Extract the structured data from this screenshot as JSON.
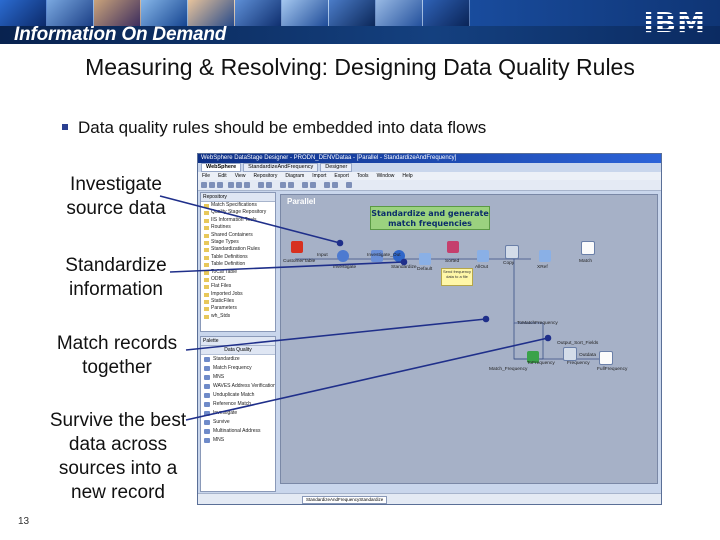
{
  "banner": {
    "title": "Information On Demand",
    "logo": "IBM"
  },
  "slide": {
    "title": "Measuring & Resolving: Designing Data Quality Rules",
    "bullet": "Data quality rules should be embedded into data flows",
    "labels": {
      "investigate": "Investigate\nsource data",
      "standardize": "Standardize\ninformation",
      "match": "Match records\ntogether",
      "survive": "Survive the best\ndata across\nsources into a\nnew record"
    },
    "page_number": "13"
  },
  "app": {
    "window_title": "WebSphere DataStage Designer - PRODN_DENVDataa - [Parallel - StandardizeAndFrequency]",
    "tabs": [
      "WebSphere",
      "StandardizeAndFrequency",
      "Designer"
    ],
    "menu": [
      "File",
      "Edit",
      "View",
      "Repository",
      "Diagram",
      "Import",
      "Export",
      "Tools",
      "Window",
      "Help"
    ],
    "repository": {
      "header": "Repository",
      "items": [
        "Match Specifications",
        "Quality Stage Repository",
        "IIS Information Tools",
        "Routines",
        "Shared Containers",
        "Stage Types",
        "Standardization Rules",
        "Table Definitions",
        "Table Definition",
        "ToCal Table",
        "ODBC",
        "Flat Files",
        "Imported Jobs",
        "StaticFiles",
        "Parameters",
        "wh_Stds"
      ]
    },
    "palette": {
      "header": "Palette",
      "group": "Data Quality",
      "items": [
        "Standardize",
        "Match Frequency",
        "MNS",
        "WAVES Address Verification",
        "Unduplicate Match",
        "Reference Match",
        "Investigate",
        "Survive",
        "Multinational Address",
        "MNS"
      ]
    },
    "canvas": {
      "name": "Parallel",
      "nodes": [
        {
          "label": "CustomerTable"
        },
        {
          "label": "Input"
        },
        {
          "label": "Investigate"
        },
        {
          "label": "Investigate_Out"
        },
        {
          "label": "Standardize"
        },
        {
          "label": "Default"
        },
        {
          "label": "Sorted"
        },
        {
          "label": "AllOut"
        },
        {
          "label": "Copy"
        },
        {
          "label": "XRef"
        },
        {
          "label": "Match"
        },
        {
          "label": "ToMatchFrequency"
        },
        {
          "label": "Match_Frequency"
        },
        {
          "label": "Output_Sort_Fields"
        },
        {
          "label": "ToFrequency"
        },
        {
          "label": "Frequency"
        },
        {
          "label": "Outdata"
        },
        {
          "label": "FullFrequency"
        }
      ],
      "note": "Send frequency data to a file"
    },
    "callout": "Standardize and generate\nmatch frequencies",
    "status_tab": "StandardizeAndFrequencyStandardize"
  },
  "colors": {
    "banner": "#123d86",
    "callout": "#9bd27f",
    "canvas": "#a6b1c7",
    "connector": "#1f2f8a"
  }
}
